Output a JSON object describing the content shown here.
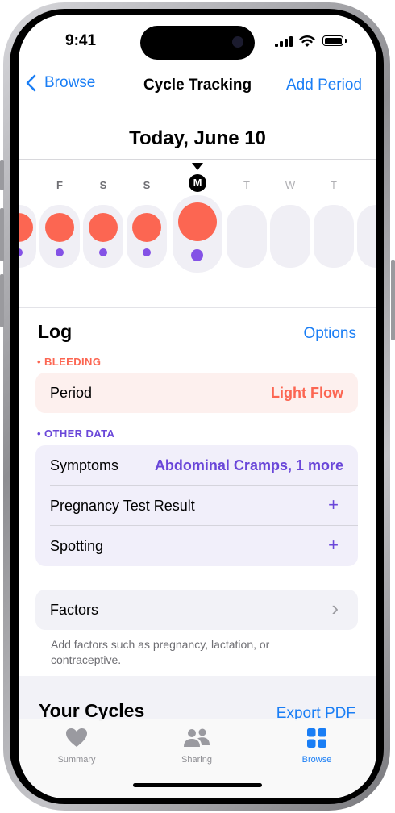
{
  "status_bar": {
    "time": "9:41"
  },
  "nav": {
    "back_label": "Browse",
    "title": "Cycle Tracking",
    "action_label": "Add Period"
  },
  "date_title": "Today, June 10",
  "week": {
    "letters": [
      "F",
      "S",
      "S",
      "M",
      "T",
      "W",
      "T"
    ],
    "today_letter": "M",
    "colors": {
      "period": "#fc6652",
      "other_data": "#8452e6"
    }
  },
  "log": {
    "title": "Log",
    "options_label": "Options",
    "bleeding_caption": "BLEEDING",
    "period_label": "Period",
    "period_value": "Light Flow",
    "other_caption": "OTHER DATA",
    "symptoms_label": "Symptoms",
    "symptoms_value": "Abdominal Cramps, 1 more",
    "pregnancy_label": "Pregnancy Test Result",
    "spotting_label": "Spotting",
    "plus_glyph": "+"
  },
  "factors": {
    "label": "Factors",
    "chevron": "›",
    "footnote": "Add factors such as pregnancy, lactation, or contraceptive."
  },
  "cycles": {
    "title": "Your Cycles",
    "export_label": "Export PDF"
  },
  "tabbar": {
    "tabs": [
      {
        "label": "Summary",
        "icon": "heart-icon"
      },
      {
        "label": "Sharing",
        "icon": "people-icon"
      },
      {
        "label": "Browse",
        "icon": "grid-icon",
        "selected": true
      }
    ]
  },
  "colors": {
    "accent": "#1a7ef5",
    "period": "#fc6652",
    "symptoms": "#6a47d9"
  }
}
